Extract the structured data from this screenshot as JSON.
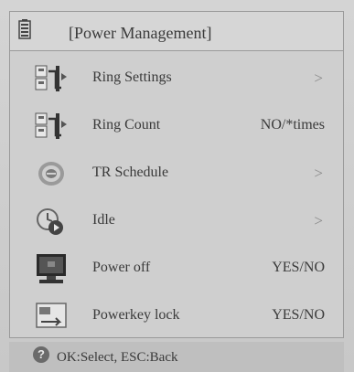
{
  "title": "[Power Management]",
  "title_icon": "battery-icon",
  "menu": {
    "items": [
      {
        "icon": "ring-settings-icon",
        "label": "Ring Settings",
        "value": ">"
      },
      {
        "icon": "ring-count-icon",
        "label": "Ring Count",
        "value": "NO/*times"
      },
      {
        "icon": "tr-schedule-icon",
        "label": "TR Schedule",
        "value": ">"
      },
      {
        "icon": "idle-icon",
        "label": "Idle",
        "value": ">"
      },
      {
        "icon": "power-off-icon",
        "label": "Power off",
        "value": "YES/NO"
      },
      {
        "icon": "powerkey-lock-icon",
        "label": "Powerkey lock",
        "value": "YES/NO"
      }
    ]
  },
  "footer": {
    "help_icon": "question-icon",
    "help_glyph": "?",
    "text": "OK:Select, ESC:Back"
  },
  "colors": {
    "background": "#c9c9c9",
    "text": "#3a3a3a",
    "border": "#9a9a9a"
  }
}
